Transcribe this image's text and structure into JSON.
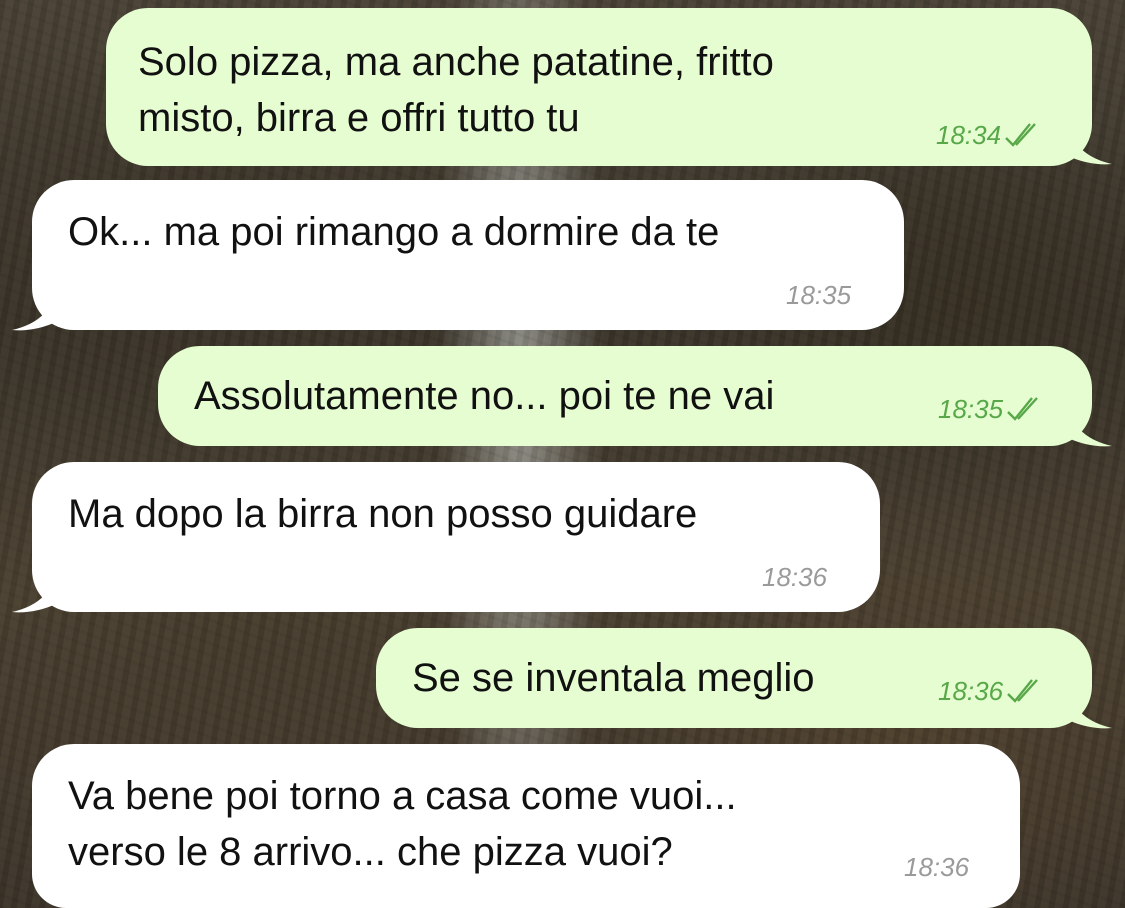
{
  "messages": [
    {
      "direction": "out",
      "text": "Solo pizza, ma anche patatine, fritto\nmisto, birra e offri tutto tu",
      "time": "18:34",
      "status_icon": "double-check-icon"
    },
    {
      "direction": "in",
      "text": "Ok... ma poi rimango a dormire da te",
      "time": "18:35"
    },
    {
      "direction": "out",
      "text": "Assolutamente no... poi te ne vai",
      "time": "18:35",
      "status_icon": "double-check-icon"
    },
    {
      "direction": "in",
      "text": "Ma dopo la birra non posso guidare",
      "time": "18:36"
    },
    {
      "direction": "out",
      "text": "Se se inventala meglio",
      "time": "18:36",
      "status_icon": "double-check-icon"
    },
    {
      "direction": "in",
      "text": "Va bene poi torno a casa come vuoi...\nverso le 8 arrivo... che pizza vuoi?",
      "time": "18:36"
    }
  ],
  "colors": {
    "outgoing_bubble": "#e6fdd1",
    "incoming_bubble": "#ffffff",
    "outgoing_time": "#58a84a",
    "incoming_time": "#9a9a9a"
  }
}
